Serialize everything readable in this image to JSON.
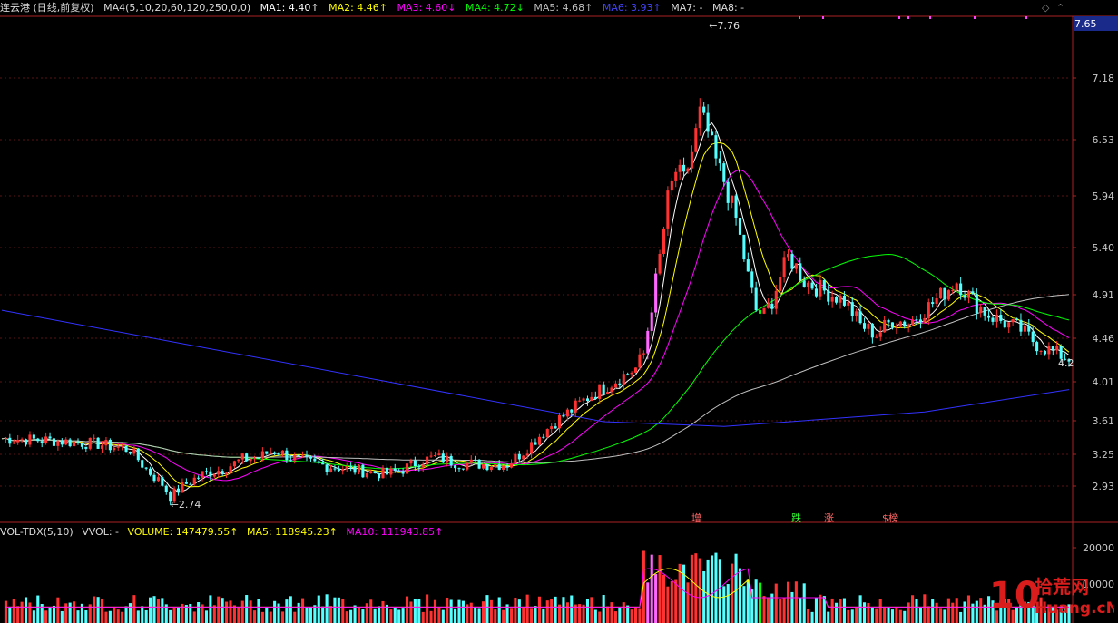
{
  "header": {
    "title": "连云港 (日线,前复权)",
    "ma_setting": "MA4(5,10,20,60,120,250,0,0)",
    "ma1": "MA1: 4.40↑",
    "ma2": "MA2: 4.46↑",
    "ma3": "MA3: 4.60↓",
    "ma4": "MA4: 4.72↓",
    "ma5": "MA5: 4.68↑",
    "ma6": "MA6: 3.93↑",
    "ma7": "MA7: -",
    "ma8": "MA8: -"
  },
  "volume_header": {
    "indicator": "VOL-TDX(5,10)",
    "vvol": "VVOL: -",
    "volume": "VOLUME: 147479.55↑",
    "ma5": "MA5: 118945.23↑",
    "ma10": "MA10: 111943.85↑"
  },
  "price_axis": {
    "current_price": "7.65",
    "ticks": [
      "7.18",
      "6.53",
      "5.94",
      "5.40",
      "4.91",
      "4.46",
      "4.01",
      "3.61",
      "3.25",
      "2.93"
    ]
  },
  "volume_axis": {
    "ticks": [
      "20000",
      "10000"
    ]
  },
  "annotations": {
    "high": "7.76",
    "low": "2.74",
    "last": "4.2"
  },
  "markers": [
    "增",
    "跌",
    "涨",
    "$榜"
  ],
  "watermark": {
    "logo": "10",
    "text_cn": "拾荒网",
    "text_en": "Huang.cN"
  },
  "colors": {
    "up": "#ff3232",
    "down": "#54ffff",
    "ma1": "#ffffff",
    "ma2": "#ffff00",
    "ma3": "#ff00ff",
    "ma4": "#00ff00",
    "ma5": "#c0c0c0",
    "ma6": "#3232ff",
    "vol_ma5": "#ffff00",
    "vol_ma10": "#ff00ff"
  },
  "chart_data": {
    "type": "candlestick",
    "ylim": [
      2.7,
      7.8
    ],
    "price_ticks": [
      7.18,
      6.53,
      5.94,
      5.4,
      4.91,
      4.46,
      4.01,
      3.61,
      3.25,
      2.93
    ],
    "high": 7.76,
    "low": 2.74,
    "last": 4.2,
    "current": 7.65,
    "volume_ticks": [
      20000,
      10000
    ]
  }
}
